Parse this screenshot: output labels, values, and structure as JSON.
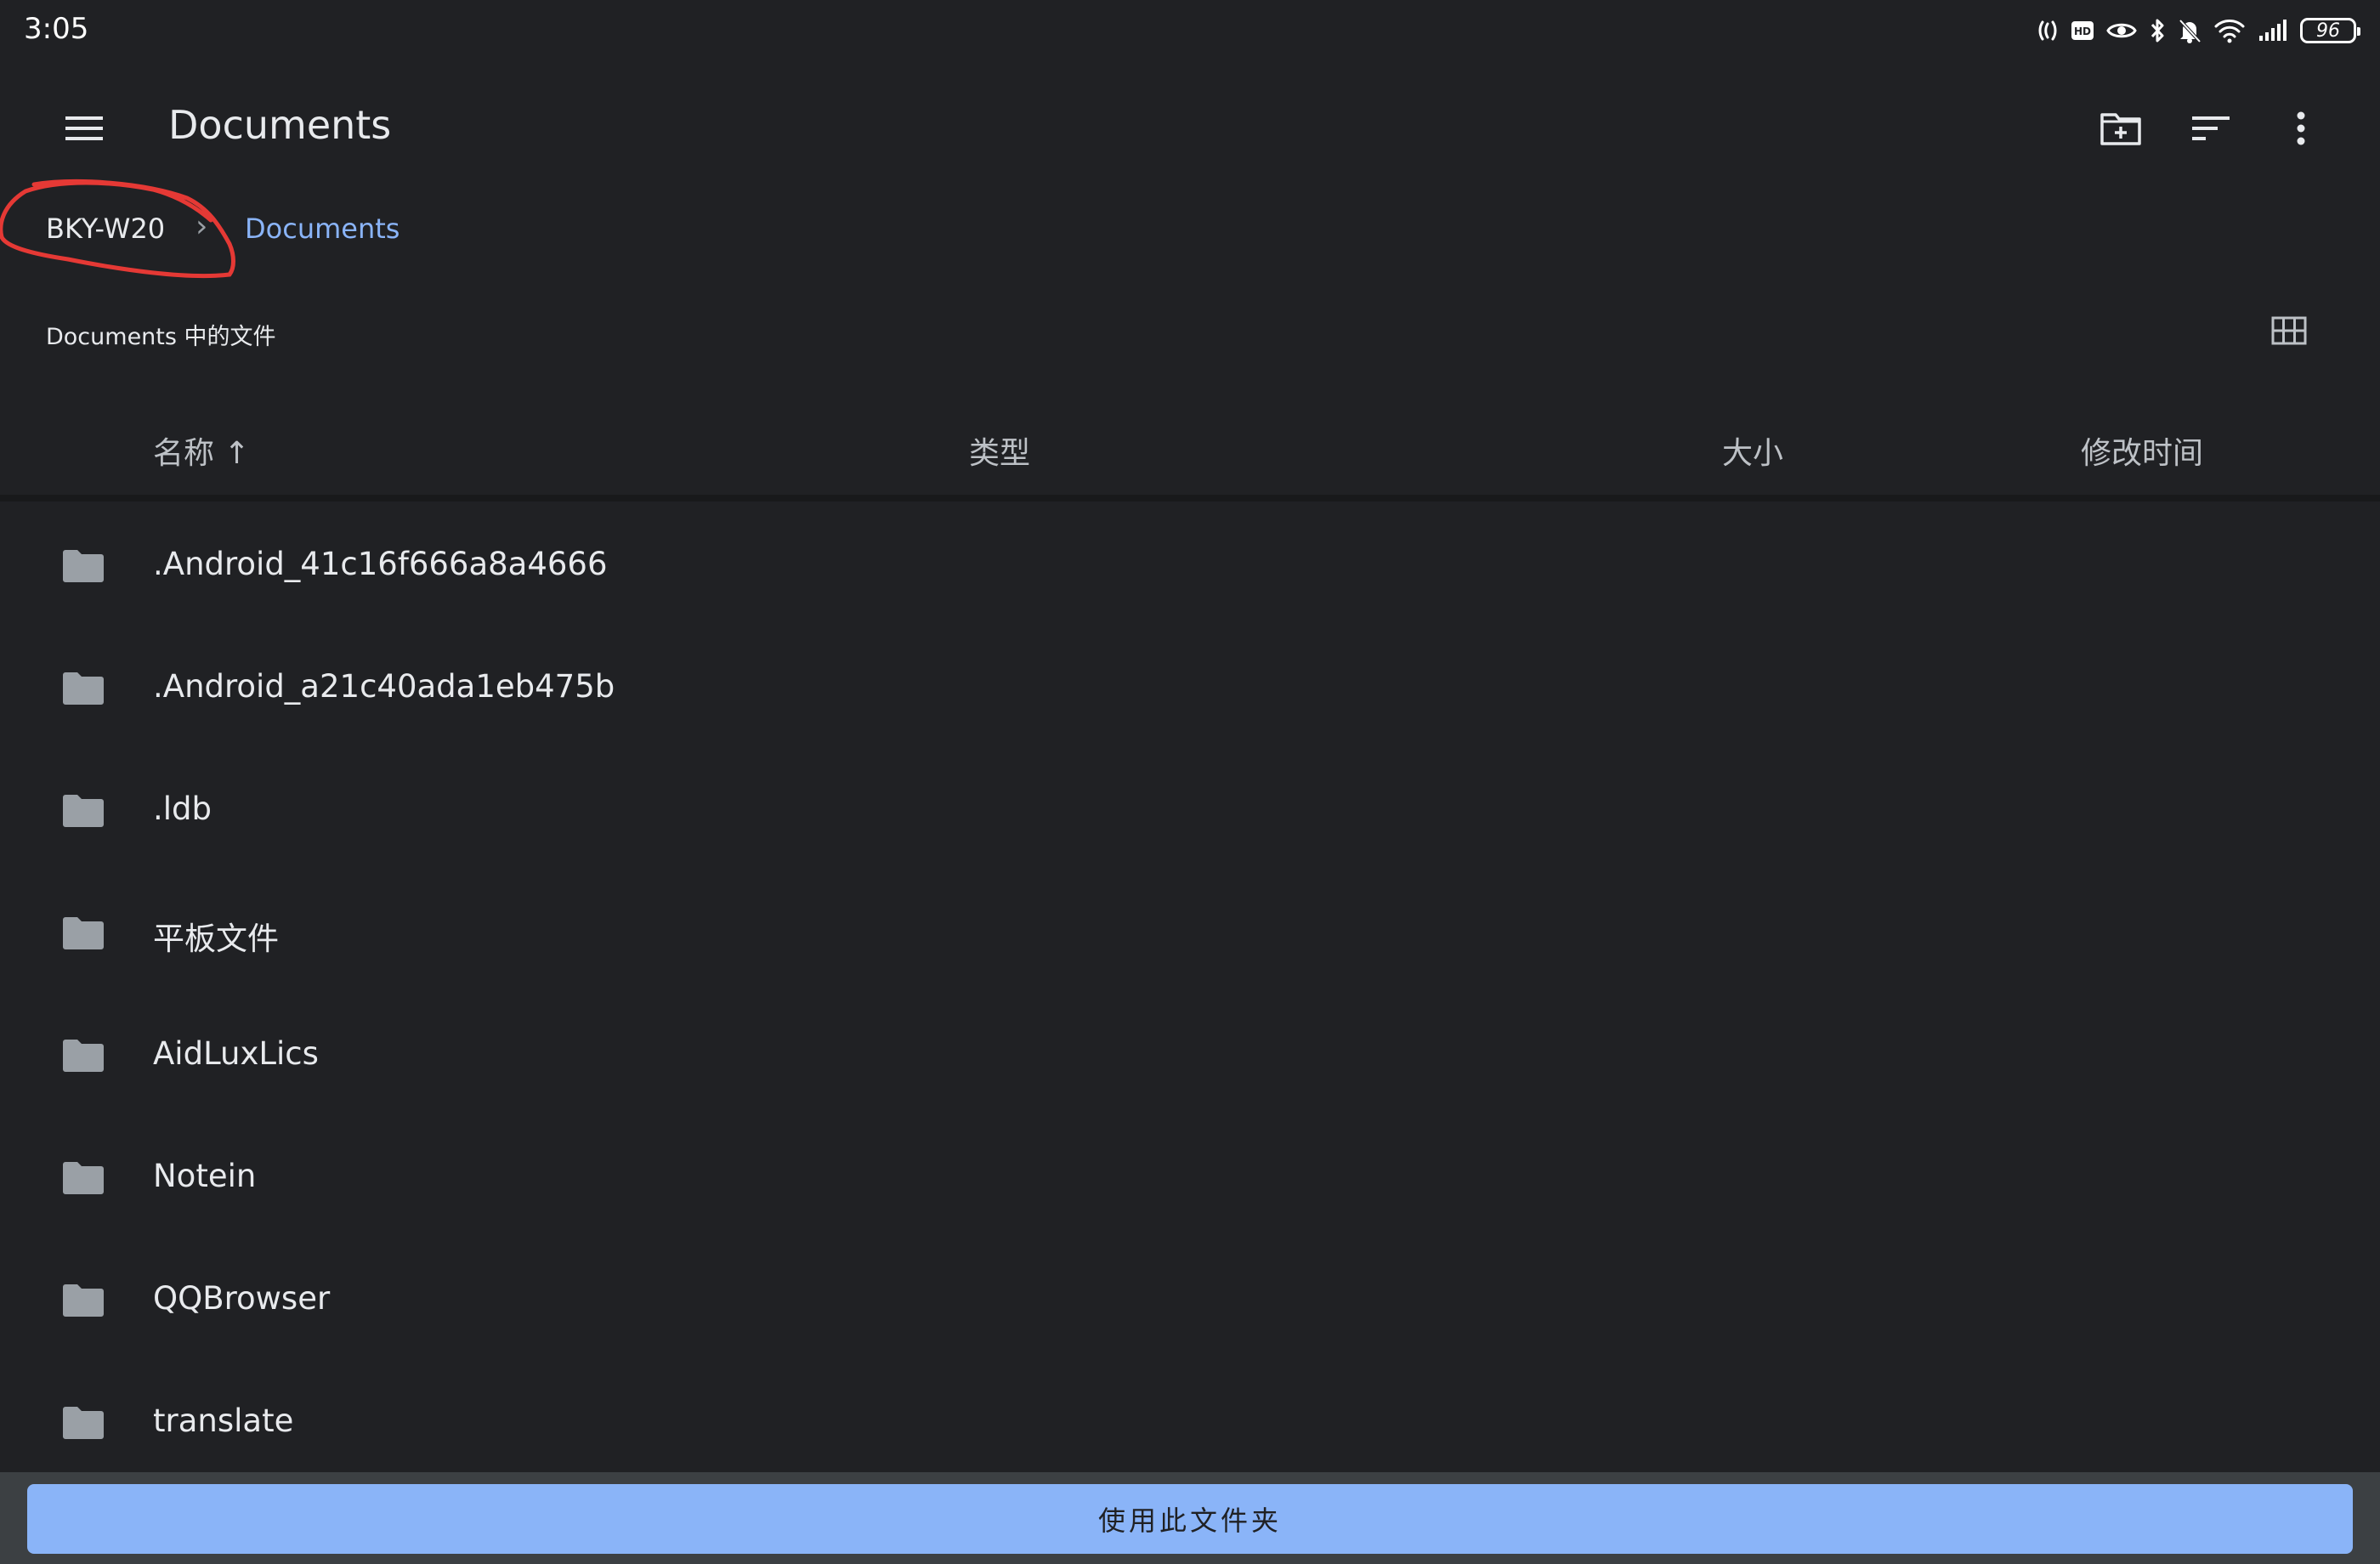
{
  "status_bar": {
    "time": "3:05",
    "icons": [
      "nfc-icon",
      "hd-icon",
      "eye-icon",
      "bluetooth-icon",
      "bell-off-icon",
      "wifi-icon",
      "signal-icon"
    ],
    "battery": "96"
  },
  "app_bar": {
    "title": "Documents",
    "menu_icon": "menu-icon",
    "actions": [
      "new-folder-icon",
      "sort-icon",
      "more-vert-icon"
    ]
  },
  "breadcrumb": {
    "root": "BKY-W20",
    "separator": "›",
    "current": "Documents"
  },
  "section": {
    "title": "Documents 中的文件",
    "view_toggle_icon": "grid-view-icon"
  },
  "columns": {
    "name": "名称 ↑",
    "type": "类型",
    "size": "大小",
    "modified": "修改时间"
  },
  "files": [
    {
      "name": ".Android_41c16f666a8a4666",
      "icon": "folder-icon"
    },
    {
      "name": ".Android_a21c40ada1eb475b",
      "icon": "folder-icon"
    },
    {
      "name": ".ldb",
      "icon": "folder-icon"
    },
    {
      "name": "平板文件",
      "icon": "folder-icon"
    },
    {
      "name": "AidLuxLics",
      "icon": "folder-icon"
    },
    {
      "name": "Notein",
      "icon": "folder-icon"
    },
    {
      "name": "QQBrowser",
      "icon": "folder-icon"
    },
    {
      "name": "translate",
      "icon": "folder-icon"
    }
  ],
  "bottom": {
    "use_folder_label": "使用此文件夹"
  },
  "colors": {
    "background": "#202124",
    "accent": "#8ab4f8",
    "annotation": "#e53935",
    "bottom_bar": "#3c4043"
  }
}
